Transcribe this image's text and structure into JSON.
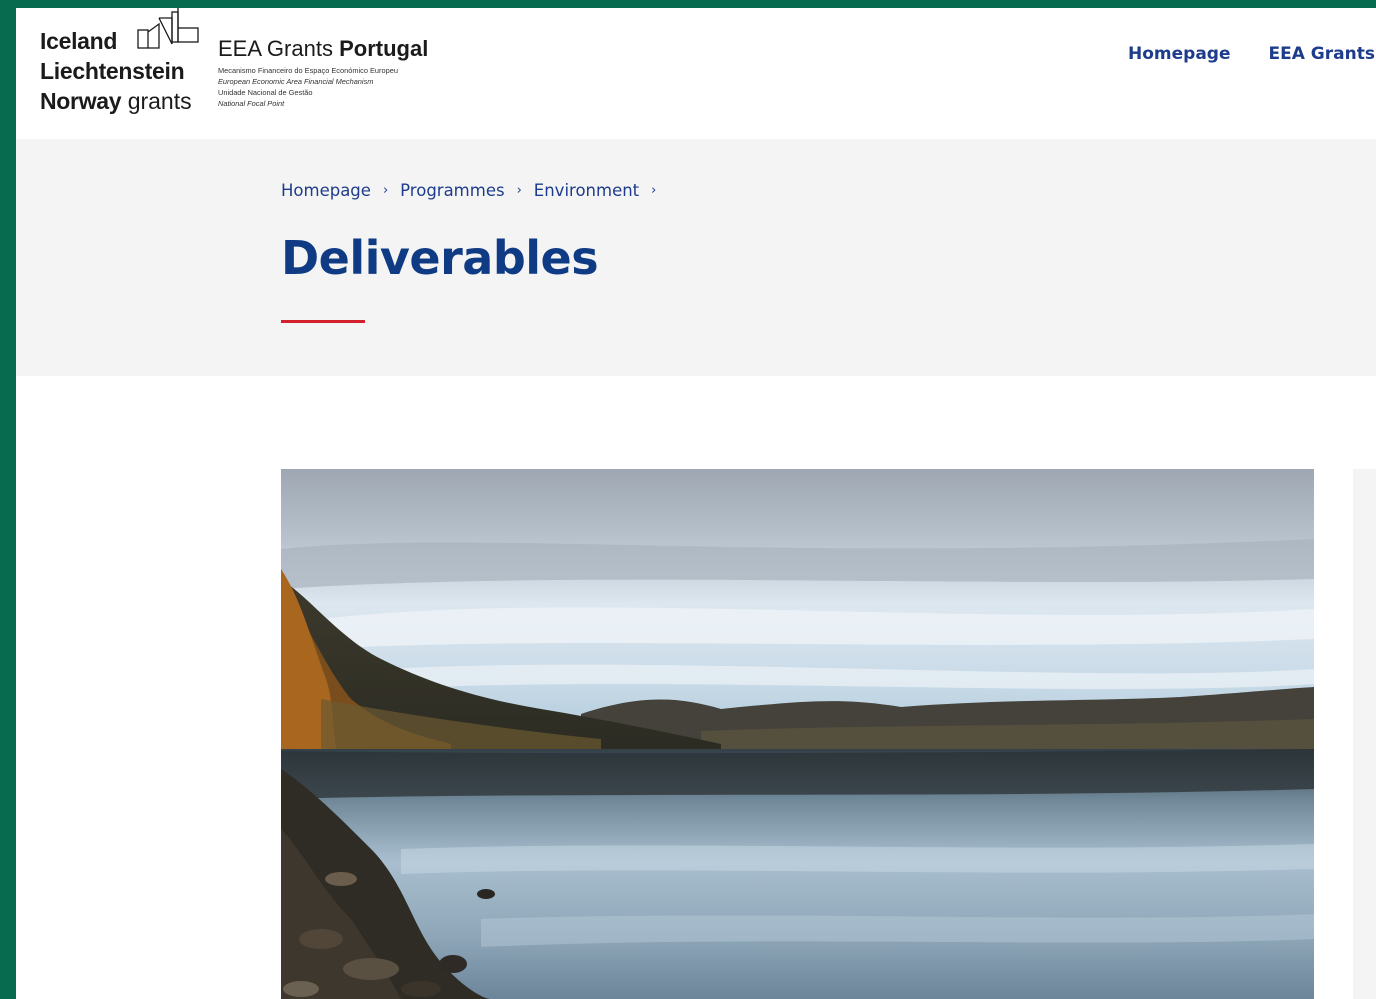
{
  "logo": {
    "line1": "Iceland",
    "line2": "Liechtenstein",
    "line3_bold": "Norway",
    "line3_normal": "grants"
  },
  "partner_logo": {
    "title_normal": "EEA Grants",
    "title_bold": "Portugal",
    "sub1": "Mecanismo Financeiro do Espaço Económico Europeu",
    "sub2": "European Economic Area Financial Mechanism",
    "sub3": "Unidade Nacional de Gestão",
    "sub4": "National Focal Point"
  },
  "nav": {
    "items": [
      {
        "label": "Homepage"
      },
      {
        "label": "EEA Grants"
      }
    ]
  },
  "breadcrumb": {
    "items": [
      {
        "label": "Homepage"
      },
      {
        "label": "Programmes"
      },
      {
        "label": "Environment"
      }
    ],
    "separator": "›"
  },
  "page": {
    "title": "Deliverables"
  },
  "colors": {
    "frame": "#076b4f",
    "brand_blue": "#0f3b85",
    "link_blue": "#1e3c8c",
    "accent_red": "#d4202c",
    "band_gray": "#f4f4f4"
  }
}
